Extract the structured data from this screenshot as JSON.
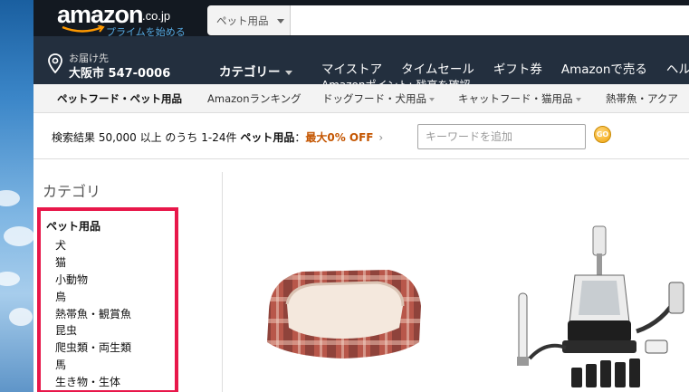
{
  "header": {
    "logo_text": "amazon",
    "logo_tld": ".co.jp",
    "prime_text": "プライムを始める",
    "search_category": "ペット用品",
    "deliver_label": "お届け先",
    "deliver_location": "大阪市 547-0006",
    "category_menu": "カテゴリー",
    "points_text": "Amazonポイント: 残高を確認",
    "nav_links": [
      "マイストア",
      "タイムセール",
      "ギフト券",
      "Amazonで売る",
      "ヘルプ"
    ]
  },
  "subnav": {
    "items": [
      {
        "label": "ペットフード・ペット用品",
        "bold": true
      },
      {
        "label": "Amazonランキング"
      },
      {
        "label": "ドッグフード・犬用品"
      },
      {
        "label": "キャットフード・猫用品"
      },
      {
        "label": "熱帯魚・アクア"
      }
    ]
  },
  "results": {
    "prefix": "検索結果 50,000 以上 のうち 1-24件",
    "category": "ペット用品",
    "colon": "：",
    "offer": "最大0% OFF",
    "chevron": "›",
    "keyword_placeholder": "キーワードを追加",
    "go_label": "GO"
  },
  "sidebar": {
    "heading": "カテゴリ",
    "root": "ペット用品",
    "items": [
      "犬",
      "猫",
      "小動物",
      "鳥",
      "熱帯魚・観賞魚",
      "昆虫",
      "爬虫類・両生類",
      "馬",
      "生き物・生体"
    ]
  },
  "colors": {
    "nav_dark": "#131921",
    "nav_main": "#232f3e",
    "highlight_box": "#e8174a",
    "offer": "#c45500"
  },
  "icons": [
    "location-pin-icon",
    "caret-down-icon",
    "go-button-icon"
  ]
}
